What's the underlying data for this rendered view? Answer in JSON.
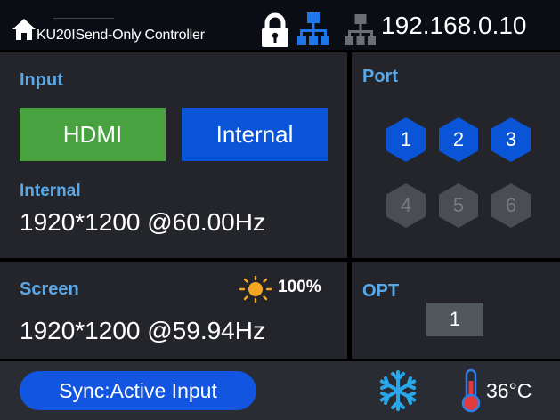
{
  "header": {
    "title": "KU20ISend-Only Controller",
    "ip": "192.168.0.10"
  },
  "input": {
    "label": "Input",
    "buttons": [
      {
        "label": "HDMI",
        "color": "#48a23f"
      },
      {
        "label": "Internal",
        "color": "#0a54d8"
      }
    ],
    "source_label": "Internal",
    "resolution": "1920*1200 @60.00Hz"
  },
  "port": {
    "label": "Port",
    "ports": [
      {
        "num": "1",
        "active": true
      },
      {
        "num": "2",
        "active": true
      },
      {
        "num": "3",
        "active": true
      },
      {
        "num": "4",
        "active": false
      },
      {
        "num": "5",
        "active": false
      },
      {
        "num": "6",
        "active": false
      }
    ]
  },
  "screen": {
    "label": "Screen",
    "brightness": "100%",
    "resolution": "1920*1200 @59.94Hz"
  },
  "opt": {
    "label": "OPT",
    "value": "1"
  },
  "footer": {
    "sync_label": "Sync:Active Input",
    "temperature": "36°C"
  },
  "icons": [
    "home-icon",
    "lock-icon",
    "network-connected-icon",
    "network-disconnected-icon",
    "sun-icon",
    "fan-icon",
    "thermometer-icon"
  ],
  "colors": {
    "accent_blue": "#1155e0",
    "label_blue": "#5aa8e6",
    "active_green": "#48a23f",
    "panel_bg": "#23252b"
  }
}
